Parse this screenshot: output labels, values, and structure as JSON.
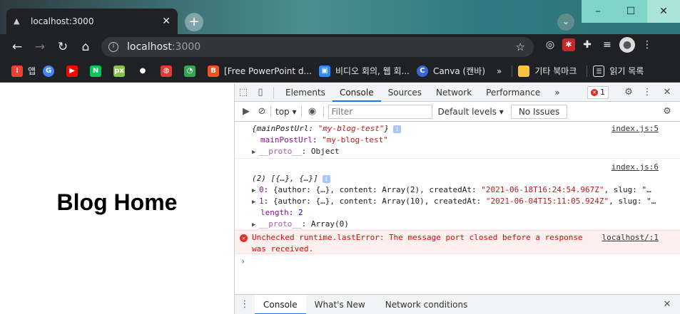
{
  "window": {
    "tab_title": "localhost:3000",
    "minimize": "–",
    "maximize": "☐",
    "close": "✕"
  },
  "toolbar": {
    "url_host": "localhost",
    "url_port": ":3000"
  },
  "bookmarks": [
    {
      "label": "앱",
      "color": "#ea4335",
      "icon": "apps-grid-icon"
    },
    {
      "label": "",
      "color": "#4285f4",
      "icon": "google-icon"
    },
    {
      "label": "",
      "color": "#ff0000",
      "icon": "youtube-icon"
    },
    {
      "label": "",
      "color": "#03c75a",
      "icon": "naver-icon"
    },
    {
      "label": "",
      "color": "#8bc34a",
      "icon": "px-icon"
    },
    {
      "label": "",
      "color": "#202124",
      "icon": "github-icon"
    },
    {
      "label": "",
      "color": "#e53935",
      "icon": "dribbble-icon"
    },
    {
      "label": "",
      "color": "#34a853",
      "icon": "green-icon"
    },
    {
      "label": "[Free PowerPoint d...",
      "color": "#f4511e",
      "icon": "blogger-icon"
    },
    {
      "label": "비디오 회의, 웹 회...",
      "color": "#2d8cff",
      "icon": "zoom-icon"
    },
    {
      "label": "Canva (캔바)",
      "color": "#3a66db",
      "icon": "canva-icon"
    }
  ],
  "bookmarks_more": "»",
  "bookmarks_folder": "기타 북마크",
  "reading_list": "읽기 목록",
  "page": {
    "heading": "Blog Home"
  },
  "devtools": {
    "tabs": [
      "Elements",
      "Console",
      "Sources",
      "Network",
      "Performance"
    ],
    "active_tab": "Console",
    "more_tabs": "»",
    "error_count": "1",
    "context": "top",
    "filter_placeholder": "Filter",
    "levels": "Default levels",
    "issues": "No Issues",
    "logs": {
      "entry1": {
        "source": "index.js:5",
        "summary_prefix": "{",
        "summary_key": "mainPostUrl",
        "summary_sep": ": ",
        "summary_val": "\"my-blog-test\"",
        "summary_suffix": "}",
        "prop_key": "mainPostUrl",
        "prop_val": "\"my-blog-test\"",
        "proto_key": "__proto__",
        "proto_val": "Object"
      },
      "entry2": {
        "source": "index.js:6",
        "summary": "(2) [{…}, {…}]",
        "item0_key": "0",
        "item0_a": "{author: {…}, content: Array(2), createdAt: ",
        "item0_date": "\"2021-06-18T16:24:54.967Z\"",
        "item0_b": ", slug: \"…",
        "item1_key": "1",
        "item1_a": "{author: {…}, content: Array(10), createdAt: ",
        "item1_date": "\"2021-06-04T15:11:05.924Z\"",
        "item1_b": ", slug: \"…",
        "length_key": "length",
        "length_val": "2",
        "proto_key": "__proto__",
        "proto_val": "Array(0)"
      },
      "error": {
        "line1": "Unchecked runtime.lastError: The message port closed before a response",
        "line2": "was received.",
        "source": "localhost/:1"
      }
    },
    "drawer_tabs": [
      "Console",
      "What's New",
      "Network conditions"
    ]
  }
}
